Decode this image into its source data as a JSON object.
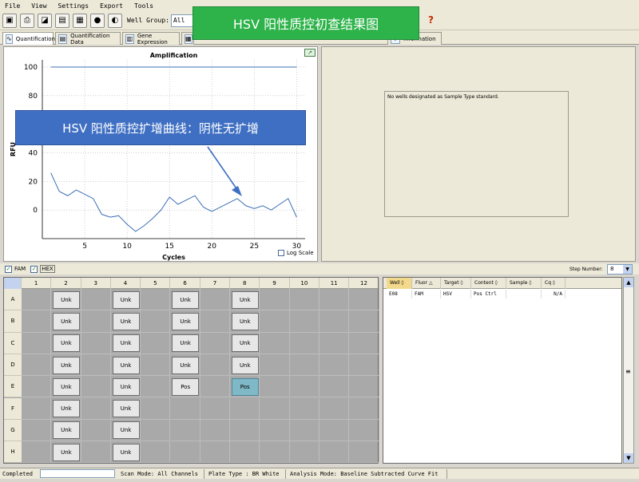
{
  "menu": [
    "File",
    "View",
    "Settings",
    "Export",
    "Tools"
  ],
  "toolbar": {
    "well_group_label": "Well Group:",
    "well_group_value": "All We"
  },
  "tabs": [
    "Quantification",
    "Quantification Data",
    "Gene Expression",
    "",
    "",
    "",
    "Information"
  ],
  "chart_data": {
    "type": "line",
    "title": "Amplification",
    "xlabel": "Cycles",
    "ylabel": "RFU",
    "xlim": [
      0,
      31
    ],
    "ylim": [
      -20,
      105
    ],
    "x_ticks": [
      5,
      10,
      15,
      20,
      25,
      30
    ],
    "y_ticks": [
      0,
      20,
      40,
      60,
      80,
      100
    ],
    "grid": true,
    "series": [
      {
        "x": [
          1,
          30
        ],
        "y": [
          100,
          100
        ]
      },
      {
        "x": [
          1,
          2,
          3,
          4,
          5,
          6,
          7,
          8,
          9,
          10,
          11,
          12,
          13,
          14,
          15,
          16,
          17,
          18,
          19,
          20,
          21,
          22,
          23,
          24,
          25,
          26,
          27,
          28,
          29,
          30
        ],
        "y": [
          26,
          13,
          10,
          14,
          11,
          8,
          -3,
          -5,
          -4,
          -10,
          -15,
          -11,
          -6,
          0,
          9,
          4,
          7,
          10,
          2,
          -1,
          2,
          5,
          8,
          3,
          1,
          3,
          0,
          4,
          8,
          -5
        ]
      }
    ]
  },
  "log_scale_label": "Log Scale",
  "std_message": "No wells designated as Sample Type standard.",
  "fluors": [
    "FAM",
    "HEX"
  ],
  "step_label": "Step Number:",
  "step_value": "8",
  "plate": {
    "columns": [
      "1",
      "2",
      "3",
      "4",
      "5",
      "6",
      "7",
      "8",
      "9",
      "10",
      "11",
      "12"
    ],
    "rows": [
      "A",
      "B",
      "C",
      "D",
      "E",
      "F",
      "G",
      "H"
    ],
    "col2": [
      "Unk",
      "Unk",
      "Unk",
      "Unk",
      "Unk",
      "Unk",
      "Unk",
      "Unk"
    ],
    "col4": [
      "Unk",
      "Unk",
      "Unk",
      "Unk",
      "Unk",
      "Unk",
      "Unk",
      "Unk"
    ],
    "col6": [
      "Unk",
      "Unk",
      "Unk",
      "Unk",
      "Pos"
    ],
    "col8": [
      "Unk",
      "Unk",
      "Unk",
      "Unk",
      "Pos"
    ]
  },
  "results": {
    "headers": [
      "Well",
      "Fluor",
      "Target",
      "Content",
      "Sample",
      "Cq"
    ],
    "row": [
      "E08",
      "FAM",
      "HSV",
      "Pos Ctrl",
      "",
      "N/A"
    ]
  },
  "status": {
    "completed": "Completed",
    "scan_mode": "Scan Mode: All Channels",
    "plate_type": "Plate Type : BR White",
    "analysis_mode": "Analysis Mode: Baseline Subtracted Curve Fit"
  },
  "overlays": {
    "title": "HSV 阳性质控初查结果图",
    "annotation": "HSV 阳性质控扩增曲线：阴性无扩增"
  }
}
